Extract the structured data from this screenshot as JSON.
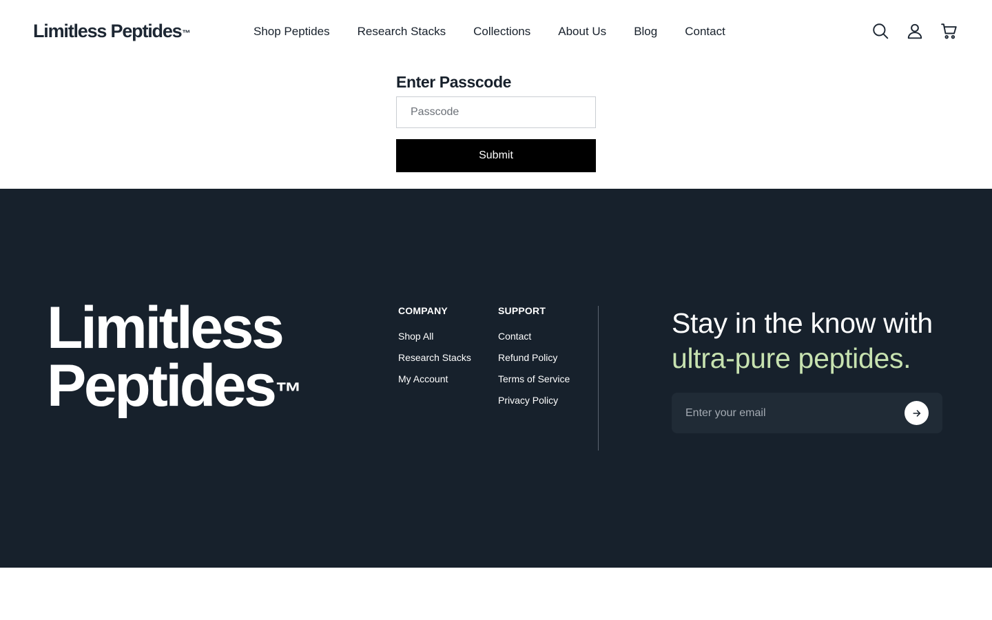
{
  "header": {
    "logo": "Limitless Peptides",
    "logo_tm": "™",
    "nav": [
      {
        "label": "Shop Peptides"
      },
      {
        "label": "Research Stacks"
      },
      {
        "label": "Collections"
      },
      {
        "label": "About Us"
      },
      {
        "label": "Blog"
      },
      {
        "label": "Contact"
      }
    ],
    "icons": [
      "search-icon",
      "account-icon",
      "cart-icon"
    ]
  },
  "passcode": {
    "title": "Enter Passcode",
    "placeholder": "Passcode",
    "value": "",
    "submit_label": "Submit"
  },
  "footer": {
    "logo_line1": "Limitless",
    "logo_line2": "Peptides",
    "logo_tm": "™",
    "company": {
      "heading": "COMPANY",
      "links": [
        {
          "label": "Shop All"
        },
        {
          "label": "Research Stacks"
        },
        {
          "label": "My Account"
        }
      ]
    },
    "support": {
      "heading": "SUPPORT",
      "links": [
        {
          "label": "Contact"
        },
        {
          "label": "Refund Policy"
        },
        {
          "label": "Terms of Service"
        },
        {
          "label": "Privacy Policy"
        }
      ]
    },
    "newsletter": {
      "heading_line1": "Stay in the know with",
      "heading_accent": "ultra-pure peptides.",
      "email_placeholder": "Enter your email",
      "email_value": ""
    }
  },
  "colors": {
    "footer_bg": "#17212c",
    "accent_green": "#c7e2b0",
    "submit_bg": "#000000"
  }
}
